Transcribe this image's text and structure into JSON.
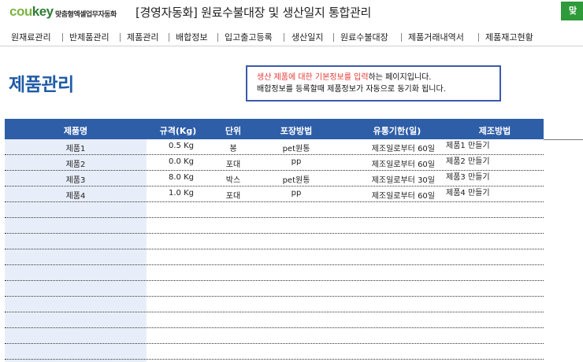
{
  "header": {
    "logo_part1": "cou",
    "logo_part2": "key",
    "logo_sub": "맞춤형엑셀업무자동화",
    "title": "[경영자동화] 원료수불대장 및 생산일지 통합관리",
    "corner_button": "맞"
  },
  "nav": {
    "items": [
      {
        "label": "원재료관리"
      },
      {
        "label": "반제품관리"
      },
      {
        "label": "제품관리"
      },
      {
        "label": "배합정보"
      },
      {
        "label": "입고출고등록"
      },
      {
        "label": "생산일지"
      },
      {
        "label": "원료수불대장"
      },
      {
        "label": "제품거래내역서"
      },
      {
        "label": "제품재고현황"
      }
    ]
  },
  "page": {
    "title": "제품관리",
    "notice_red": "생산 제품에 대한 기본정보를 입력",
    "notice_line1_rest": "하는 페이지입니다.",
    "notice_line2": "배합정보를 등록할때 제품정보가 자동으로 동기화 됩니다."
  },
  "table": {
    "columns": [
      "제품명",
      "규격(Kg)",
      "단위",
      "포장방법",
      "유통기한(일)",
      "제조방법"
    ],
    "rows": [
      {
        "name": "제품1",
        "spec": "0.5 Kg",
        "unit": "봉",
        "pack": "pet원통",
        "shelf": "제조일로부터 60일",
        "method": "제품1 만들기"
      },
      {
        "name": "제품2",
        "spec": "0.0 Kg",
        "unit": "포대",
        "pack": "pp",
        "shelf": "제조일로부터 60일",
        "method": "제품2 만들기"
      },
      {
        "name": "제품3",
        "spec": "8.0 Kg",
        "unit": "박스",
        "pack": "pet원통",
        "shelf": "제조일로부터 30일",
        "method": "제품3 만들기"
      },
      {
        "name": "제품4",
        "spec": "1.0 Kg",
        "unit": "포대",
        "pack": "pp",
        "shelf": "제조일로부터 60일",
        "method": "제품4 만들기"
      }
    ]
  }
}
